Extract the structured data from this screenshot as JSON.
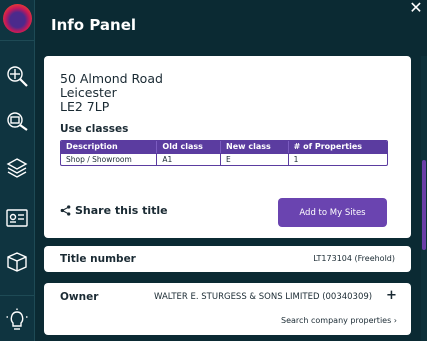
{
  "header": {
    "title": "Info Panel",
    "close_icon": "close-icon"
  },
  "sidebar": {
    "logo": "app-logo",
    "icons": [
      "search-magnify-icon",
      "measure-search-icon",
      "layers-icon",
      "id-card-icon",
      "map-3d-icon",
      "lightbulb-icon"
    ]
  },
  "property": {
    "address_line1": "50 Almond Road",
    "address_line2": "Leicester",
    "address_line3": "LE2 7LP"
  },
  "use_classes": {
    "title": "Use classes",
    "headers": [
      "Description",
      "Old class",
      "New class",
      "# of Properties"
    ],
    "rows": [
      [
        "Shop / Showroom",
        "A1",
        "E",
        "1"
      ]
    ]
  },
  "actions": {
    "share_label": "Share this title",
    "add_label": "Add to My Sites"
  },
  "title_number": {
    "label": "Title number",
    "value": "LT173104 (Freehold)"
  },
  "owner": {
    "label": "Owner",
    "value": "WALTER E. STURGESS & SONS LIMITED (00340309)",
    "expand": "+",
    "search_link": "Search company properties ›"
  },
  "colors": {
    "background": "#0b2a33",
    "accent": "#6a44b0",
    "card": "#ffffff"
  }
}
